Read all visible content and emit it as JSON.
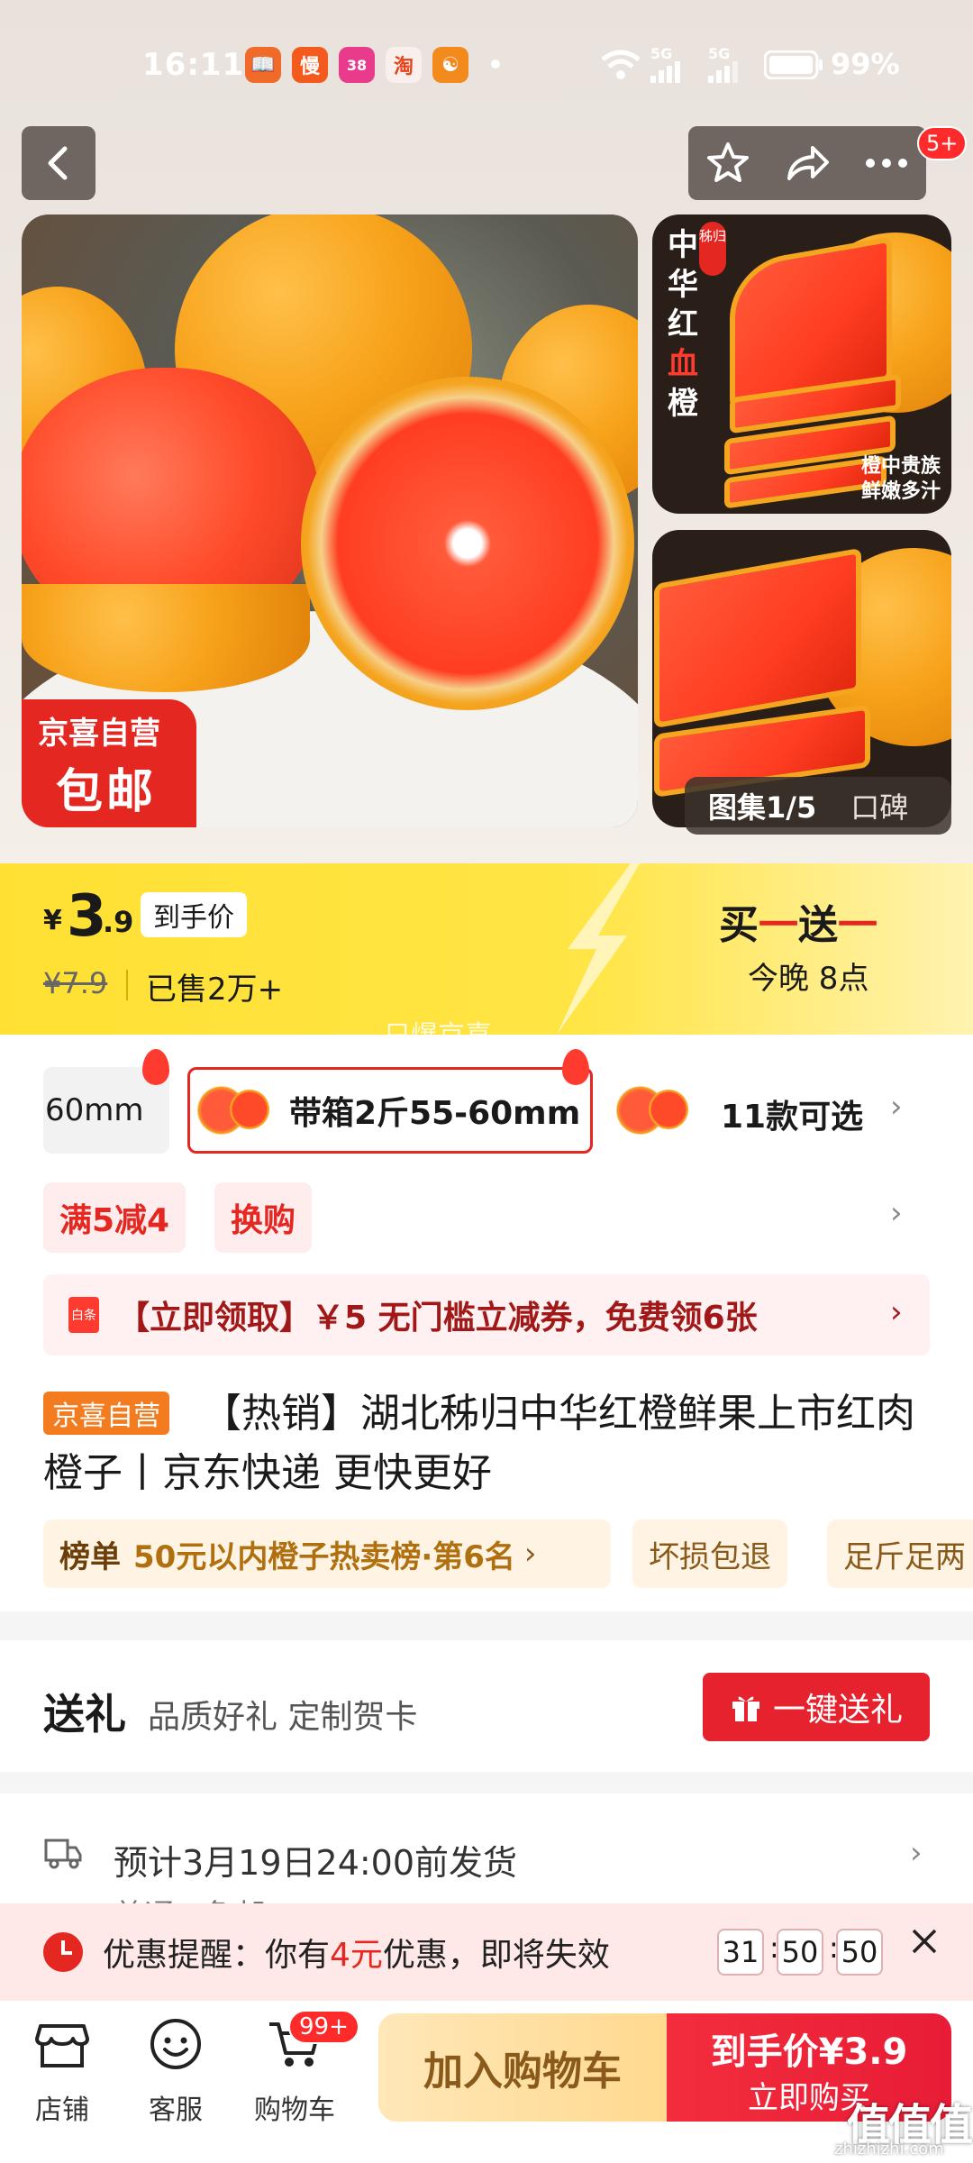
{
  "status_bar": {
    "time": "16:11",
    "net1": "5G",
    "net2": "5G",
    "battery": "99%",
    "apps": [
      "📖",
      "慢",
      "38",
      "淘",
      "☯"
    ]
  },
  "header": {
    "notification_count": "5+"
  },
  "gallery": {
    "main_badge_line1": "京喜自营",
    "main_badge_line2": "包邮",
    "thumb1_vertical_text": [
      "中",
      "华",
      "红",
      "血",
      "橙"
    ],
    "thumb1_corner_tag": "秭归",
    "thumb1_caption_line1": "橙中贵族",
    "thumb1_caption_line2": "鲜嫩多汁",
    "counter": "图集1/5",
    "reviews": "口碑"
  },
  "price": {
    "currency": "¥",
    "integer": "3",
    "decimal": ".9",
    "label": "到手价",
    "original": "¥7.9",
    "sold": "已售2万+",
    "promo_title_a": "买",
    "promo_title_b": "一",
    "promo_title_c": "送",
    "promo_title_d": "一",
    "promo_time": "今晚 8点",
    "watermark": "只爆京喜"
  },
  "sku": {
    "prev_label": "60mm",
    "active_label": "带箱2斤55-60mm",
    "count_label": "11款可选"
  },
  "tags": [
    "满5减4",
    "换购"
  ],
  "coupon": {
    "icon_label": "白条",
    "text": "【立即领取】￥5 无门槛立减券，免费领6张"
  },
  "product": {
    "shop_tag": "京喜自营",
    "title": "【热销】湖北秭归中华红橙鲜果上市红肉橙子丨京东快递 更快更好"
  },
  "rank": {
    "prefix": "榜单",
    "text": "50元以内橙子热卖榜·第6名",
    "service1": "坏损包退",
    "service2": "足斤足两"
  },
  "gift": {
    "title": "送礼",
    "subtitle": "品质好礼 定制贺卡",
    "button": "一键送礼"
  },
  "shipping": {
    "text": "预计3月19日24:00前发货",
    "text2": "普通 · 免邮"
  },
  "reminder": {
    "prefix": "优惠提醒：你有",
    "amount": "4元",
    "suffix": "优惠，即将失效",
    "hours": "31",
    "minutes": "50",
    "seconds": "50",
    "sep": ":"
  },
  "bottom_bar": {
    "store": "店铺",
    "service": "客服",
    "cart": "购物车",
    "cart_badge": "99+",
    "add_cart": "加入购物车",
    "buy_price": "到手价¥3.9",
    "buy_label": "立即购买"
  },
  "watermark": {
    "logo": "值值值",
    "url": "zhizhizhi.com"
  }
}
